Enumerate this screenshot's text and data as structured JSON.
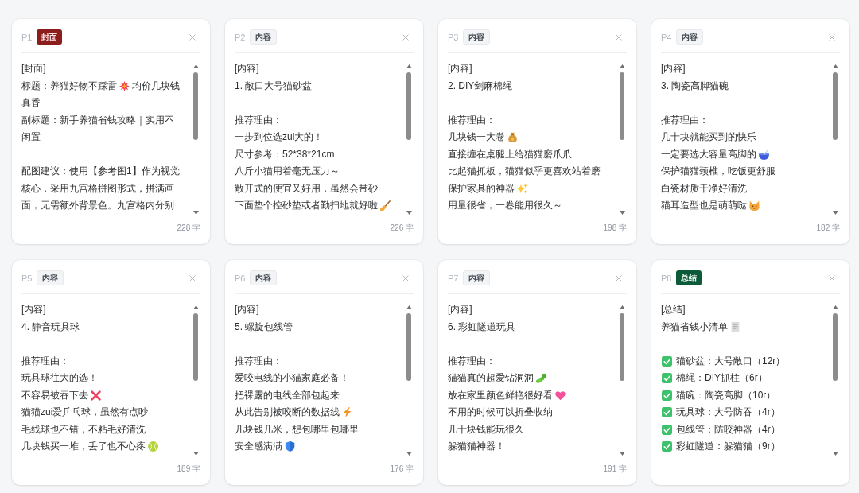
{
  "cards": [
    {
      "page": "P1",
      "badge": {
        "label": "封面",
        "kind": "cover"
      },
      "char_count": "228 字",
      "paragraphs": [
        [
          {
            "kind": "plain",
            "text": "[封面]"
          },
          {
            "kind": "burst",
            "text": "标题：养猫好物不踩雷",
            "after": "均价几块钱"
          },
          {
            "kind": "plain",
            "text": "真香"
          },
          {
            "kind": "plain",
            "text": "副标题：新手养猫省钱攻略｜实用不"
          },
          {
            "kind": "plain",
            "text": "闲置"
          }
        ],
        [
          {
            "kind": "plain",
            "text": "配图建议：使用【参考图1】作为视觉"
          },
          {
            "kind": "plain",
            "text": "核心，采用九宫格拼图形式，拼满画"
          },
          {
            "kind": "plain",
            "text": "面，无需额外背景色。九宫格内分别"
          }
        ]
      ]
    },
    {
      "page": "P2",
      "badge": {
        "label": "内容",
        "kind": "content"
      },
      "char_count": "226 字",
      "paragraphs": [
        [
          {
            "kind": "plain",
            "text": "[内容]"
          },
          {
            "kind": "plain",
            "text": "1. 敞口大号猫砂盆"
          }
        ],
        [
          {
            "kind": "plain",
            "text": "推荐理由："
          },
          {
            "kind": "plain",
            "text": "一步到位选zui大的！"
          },
          {
            "kind": "plain",
            "text": "尺寸参考：52*38*21cm"
          },
          {
            "kind": "plain",
            "text": "八斤小猫用着毫无压力～"
          },
          {
            "kind": "plain",
            "text": "敞开式的便宜又好用，虽然会带砂"
          },
          {
            "kind": "broom",
            "text": "下面垫个控砂垫或者勤扫地就好啦"
          }
        ]
      ]
    },
    {
      "page": "P3",
      "badge": {
        "label": "内容",
        "kind": "content"
      },
      "char_count": "198 字",
      "paragraphs": [
        [
          {
            "kind": "plain",
            "text": "[内容]"
          },
          {
            "kind": "plain",
            "text": "2. DIY剑麻棉绳"
          }
        ],
        [
          {
            "kind": "plain",
            "text": "推荐理由："
          },
          {
            "kind": "moneybag",
            "text": "几块钱一大卷"
          },
          {
            "kind": "plain",
            "text": "直接缠在桌腿上给猫猫磨爪爪"
          },
          {
            "kind": "plain",
            "text": "比起猫抓板，猫猫似乎更喜欢站着磨"
          },
          {
            "kind": "sparkles",
            "text": "保护家具的神器"
          },
          {
            "kind": "plain",
            "text": "用量很省，一卷能用很久～"
          }
        ]
      ]
    },
    {
      "page": "P4",
      "badge": {
        "label": "内容",
        "kind": "content"
      },
      "char_count": "182 字",
      "paragraphs": [
        [
          {
            "kind": "plain",
            "text": "[内容]"
          },
          {
            "kind": "plain",
            "text": "3. 陶瓷高脚猫碗"
          }
        ],
        [
          {
            "kind": "plain",
            "text": "推荐理由："
          },
          {
            "kind": "plain",
            "text": "几十块就能买到的快乐"
          },
          {
            "kind": "bowl",
            "text": "一定要选大容量高脚的"
          },
          {
            "kind": "plain",
            "text": "保护猫猫颈椎，吃饭更舒服"
          },
          {
            "kind": "plain",
            "text": "白瓷材质干净好清洗"
          },
          {
            "kind": "cat",
            "text": "猫耳造型也是萌萌哒"
          }
        ]
      ]
    },
    {
      "page": "P5",
      "badge": {
        "label": "内容",
        "kind": "content"
      },
      "char_count": "189 字",
      "paragraphs": [
        [
          {
            "kind": "plain",
            "text": "[内容]"
          },
          {
            "kind": "plain",
            "text": "4. 静音玩具球"
          }
        ],
        [
          {
            "kind": "plain",
            "text": "推荐理由："
          },
          {
            "kind": "plain",
            "text": "玩具球往大的选！"
          },
          {
            "kind": "cross",
            "text": "不容易被吞下去"
          },
          {
            "kind": "plain",
            "text": "猫猫zui爱乒乓球，虽然有点吵"
          },
          {
            "kind": "plain",
            "text": "毛线球也不错，不粘毛好清洗"
          },
          {
            "kind": "tennis",
            "text": "几块钱买一堆，丢了也不心疼"
          }
        ]
      ]
    },
    {
      "page": "P6",
      "badge": {
        "label": "内容",
        "kind": "content"
      },
      "char_count": "176 字",
      "paragraphs": [
        [
          {
            "kind": "plain",
            "text": "[内容]"
          },
          {
            "kind": "plain",
            "text": "5. 螺旋包线管"
          }
        ],
        [
          {
            "kind": "plain",
            "text": "推荐理由："
          },
          {
            "kind": "plain",
            "text": "爱咬电线的小猫家庭必备！"
          },
          {
            "kind": "plain",
            "text": "把裸露的电线全部包起来"
          },
          {
            "kind": "lightning",
            "text": "从此告别被咬断的数据线"
          },
          {
            "kind": "plain",
            "text": "几块钱几米，想包哪里包哪里"
          },
          {
            "kind": "shield",
            "text": "安全感满满"
          }
        ]
      ]
    },
    {
      "page": "P7",
      "badge": {
        "label": "内容",
        "kind": "content"
      },
      "char_count": "191 字",
      "paragraphs": [
        [
          {
            "kind": "plain",
            "text": "[内容]"
          },
          {
            "kind": "plain",
            "text": "6. 彩虹隧道玩具"
          }
        ],
        [
          {
            "kind": "plain",
            "text": "推荐理由："
          },
          {
            "kind": "caterpillar",
            "text": "猫猫真的超爱钻洞洞"
          },
          {
            "kind": "heart",
            "text": "放在家里颜色鲜艳很好看"
          },
          {
            "kind": "plain",
            "text": "不用的时候可以折叠收纳"
          },
          {
            "kind": "plain",
            "text": "几十块钱能玩很久"
          },
          {
            "kind": "plain",
            "text": "躲猫猫神器！"
          }
        ]
      ]
    },
    {
      "page": "P8",
      "badge": {
        "label": "总结",
        "kind": "summary"
      },
      "paragraphs": [
        [
          {
            "kind": "plain",
            "text": "[总结]"
          },
          {
            "kind": "receipt",
            "text": "养猫省钱小清单"
          }
        ],
        [
          {
            "kind": "check",
            "text": "猫砂盆：大号敞口（12r）"
          },
          {
            "kind": "check",
            "text": "棉绳：DIY抓柱（6r）"
          },
          {
            "kind": "check",
            "text": "猫碗：陶瓷高脚（10r）"
          },
          {
            "kind": "check",
            "text": "玩具球：大号防吞（4r）"
          },
          {
            "kind": "check",
            "text": "包线管：防咬神器（4r）"
          },
          {
            "kind": "check",
            "text": "彩虹隧道：躲猫猫（9r）"
          }
        ]
      ]
    }
  ]
}
